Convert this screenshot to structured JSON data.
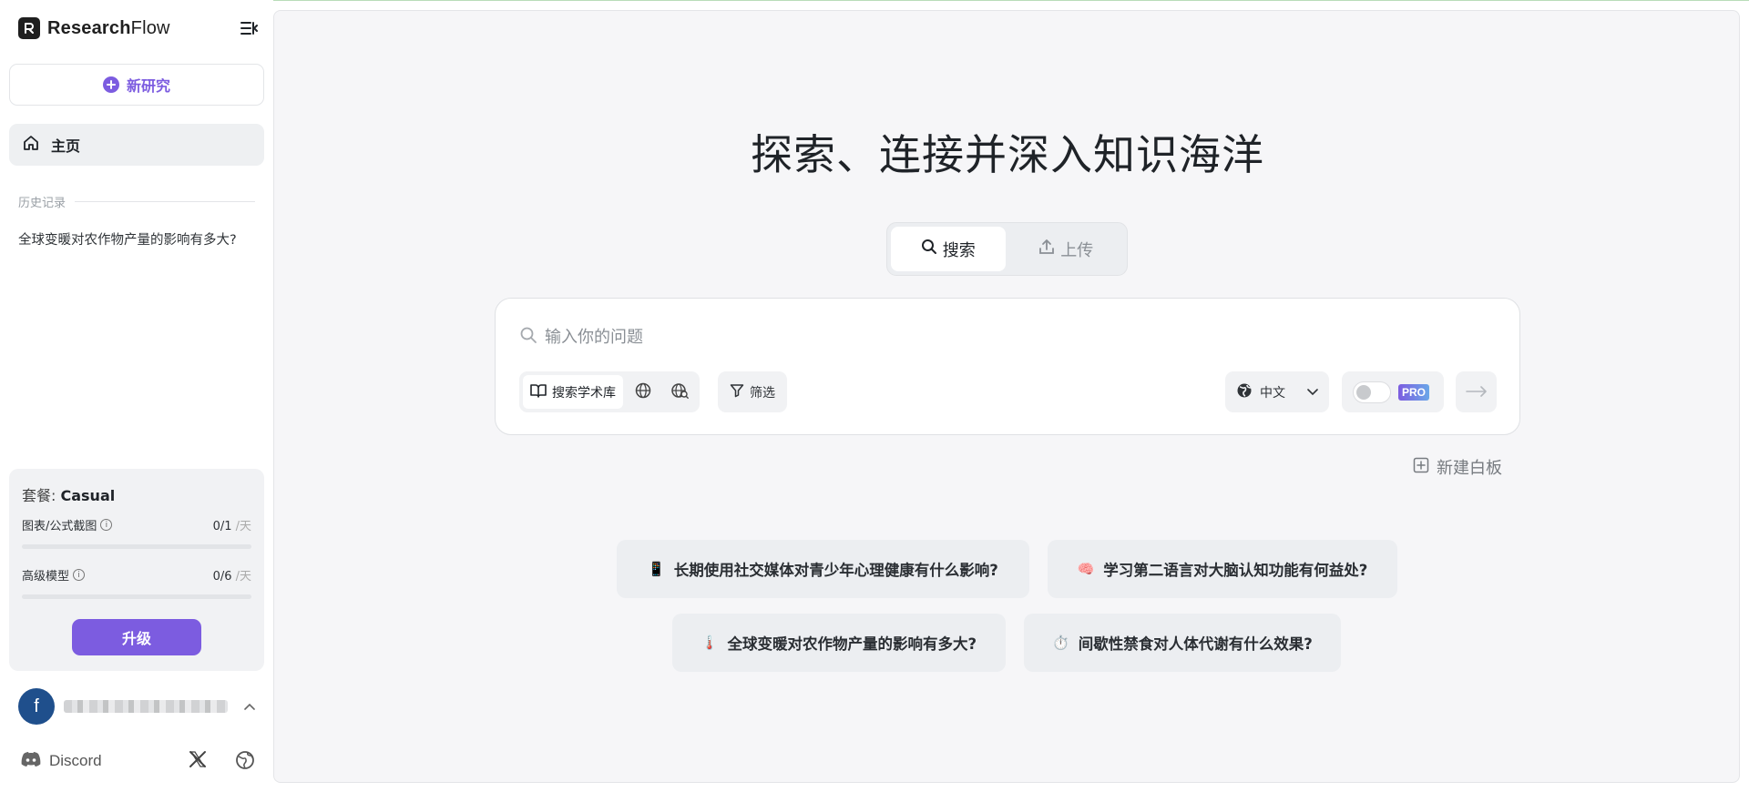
{
  "sidebar": {
    "brand": {
      "name_bold": "Research",
      "name_light": "Flow"
    },
    "new_research_label": "新研究",
    "nav": {
      "home_label": "主页"
    },
    "history": {
      "heading": "历史记录",
      "items": [
        {
          "label": "全球变暖对农作物产量的影响有多大?"
        }
      ]
    },
    "plan": {
      "prefix": "套餐: ",
      "name": "Casual",
      "quotas": [
        {
          "label": "图表/公式截图",
          "used": "0/1",
          "unit": " /天",
          "fraction": 0
        },
        {
          "label": "高级模型",
          "used": "0/6",
          "unit": " /天",
          "fraction": 0
        }
      ],
      "upgrade_label": "升级"
    },
    "user": {
      "avatar_letter": "f"
    },
    "footer": {
      "discord_label": "Discord"
    }
  },
  "main": {
    "hero_title": "探索、连接并深入知识海洋",
    "tabs": [
      {
        "label": "搜索",
        "icon": "search-icon",
        "active": true
      },
      {
        "label": "上传",
        "icon": "upload-icon",
        "active": false
      }
    ],
    "search": {
      "placeholder": "输入你的问题",
      "source_label": "搜索学术库",
      "filter_label": "筛选",
      "language_label": "中文",
      "pro_label": "PRO"
    },
    "new_board_label": "新建白板",
    "suggestions": [
      {
        "emoji": "📱",
        "label": "长期使用社交媒体对青少年心理健康有什么影响?"
      },
      {
        "emoji": "🧠",
        "label": "学习第二语言对大脑认知功能有何益处?"
      },
      {
        "emoji": "🌡️",
        "label": "全球变暖对农作物产量的影响有多大?"
      },
      {
        "emoji": "⏱️",
        "label": "间歇性禁食对人体代谢有什么效果?"
      }
    ]
  },
  "colors": {
    "accent": "#7c5ce0",
    "avatar": "#1f4f8c"
  }
}
